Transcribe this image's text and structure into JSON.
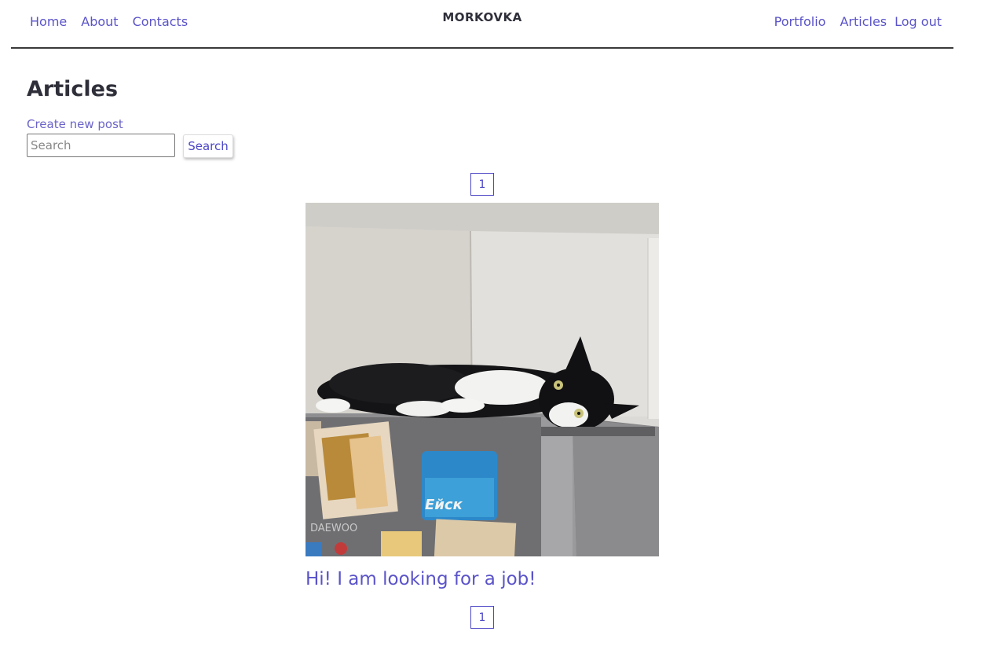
{
  "nav": {
    "left": [
      {
        "label": "Home"
      },
      {
        "label": "About"
      },
      {
        "label": "Contacts"
      }
    ],
    "brand": "MORKOVKA",
    "right": [
      {
        "label": "Portfolio"
      },
      {
        "label": "Articles"
      },
      {
        "label": "Log out"
      }
    ]
  },
  "page": {
    "title": "Articles",
    "create_link": "Create new post"
  },
  "search": {
    "placeholder": "Search",
    "value": "",
    "button_label": "Search"
  },
  "pagination": {
    "top_current": "1",
    "bottom_current": "1"
  },
  "posts": [
    {
      "title": "Hi! I am looking for a job!",
      "image_icon": "cat-on-fridge-photo",
      "fridge_brand": "DAEWOO",
      "magnet_text": "Ейск"
    }
  ]
}
